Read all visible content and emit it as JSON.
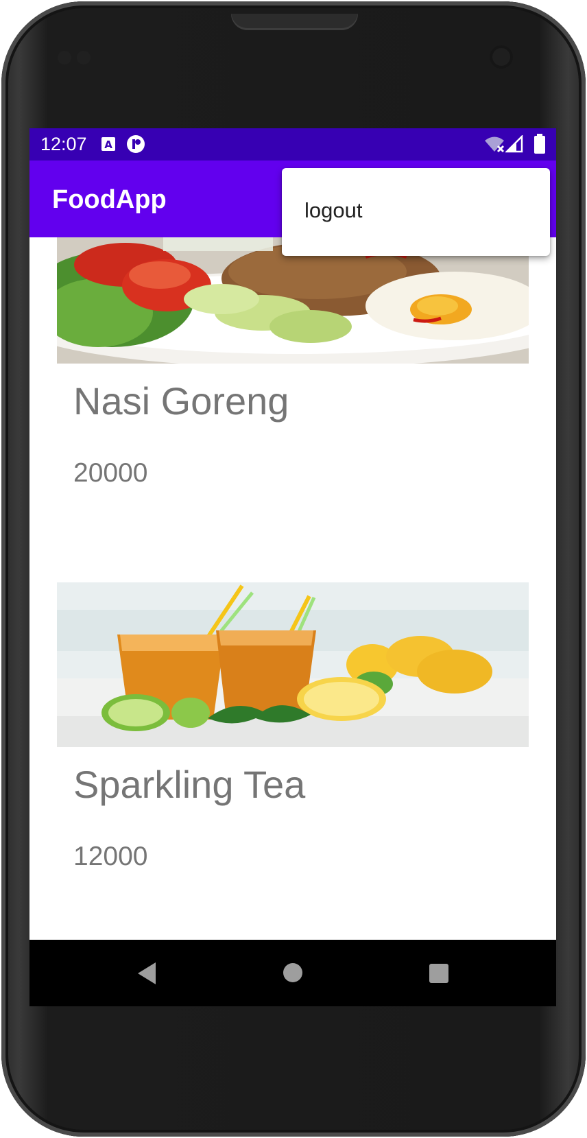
{
  "status_bar": {
    "time": "12:07",
    "icons": [
      "a-badge-icon",
      "circle-app-icon",
      "wifi-off-icon",
      "signal-icon",
      "battery-icon"
    ]
  },
  "app_bar": {
    "title": "FoodApp"
  },
  "overflow_menu": {
    "items": [
      {
        "label": "logout"
      }
    ]
  },
  "foods": [
    {
      "name": "Nasi Goreng",
      "price": "20000",
      "image": "nasi-goreng-photo"
    },
    {
      "name": "Sparkling Tea",
      "price": "12000",
      "image": "iced-tea-photo"
    }
  ],
  "nav_bar": {
    "buttons": [
      "back-icon",
      "home-icon",
      "recents-icon"
    ]
  },
  "colors": {
    "status_bar": "#3700b3",
    "app_bar": "#6200ee",
    "text_secondary": "#757575"
  }
}
